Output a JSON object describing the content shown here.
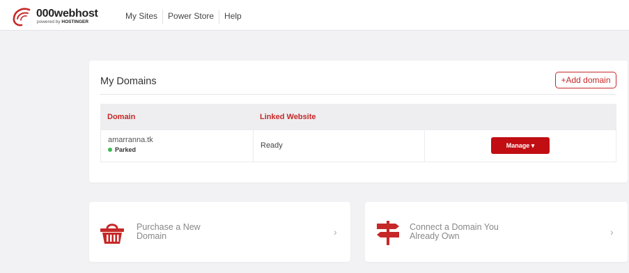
{
  "brand": {
    "name": "000webhost",
    "tagline_prefix": "powered by ",
    "tagline_brand": "HOSTINGER",
    "accent": "#c62828"
  },
  "nav": {
    "items": [
      {
        "label": "My Sites"
      },
      {
        "label": "Power Store"
      },
      {
        "label": "Help"
      }
    ]
  },
  "domains": {
    "title": "My Domains",
    "add_label": "+Add domain",
    "columns": [
      "Domain",
      "Linked Website"
    ],
    "rows": [
      {
        "domain": "amarranna.tk",
        "status": "Parked",
        "status_color": "#3cba54",
        "linked": "Ready",
        "manage_label": "Manage ▾"
      }
    ]
  },
  "promos": [
    {
      "line1": "Purchase a New",
      "line2": "Domain",
      "icon": "basket-icon"
    },
    {
      "line1": "Connect a Domain You",
      "line2": "Already Own",
      "icon": "signpost-icon"
    }
  ]
}
